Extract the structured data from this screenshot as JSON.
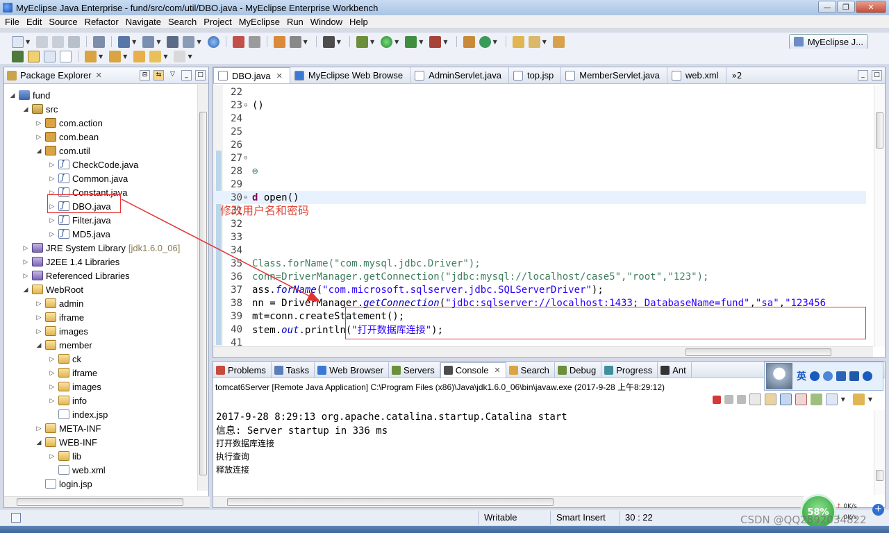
{
  "window": {
    "title": "MyEclipse Java Enterprise - fund/src/com/util/DBO.java - MyEclipse Enterprise Workbench"
  },
  "menu": [
    "File",
    "Edit",
    "Source",
    "Refactor",
    "Navigate",
    "Search",
    "Project",
    "MyEclipse",
    "Run",
    "Window",
    "Help"
  ],
  "perspective": {
    "label": "MyEclipse J..."
  },
  "package_explorer": {
    "title": "Package Explorer",
    "tree": [
      {
        "label": "fund",
        "icon": "project",
        "depth": 0,
        "twisty": "expanded"
      },
      {
        "label": "src",
        "icon": "srcfolder",
        "depth": 1,
        "twisty": "expanded"
      },
      {
        "label": "com.action",
        "icon": "package",
        "depth": 2,
        "twisty": "collapsed"
      },
      {
        "label": "com.bean",
        "icon": "package",
        "depth": 2,
        "twisty": "collapsed"
      },
      {
        "label": "com.util",
        "icon": "package",
        "depth": 2,
        "twisty": "expanded"
      },
      {
        "label": "CheckCode.java",
        "icon": "java",
        "depth": 3,
        "twisty": "collapsed"
      },
      {
        "label": "Common.java",
        "icon": "java",
        "depth": 3,
        "twisty": "collapsed"
      },
      {
        "label": "Constant.java",
        "icon": "java",
        "depth": 3,
        "twisty": "collapsed"
      },
      {
        "label": "DBO.java",
        "icon": "java",
        "depth": 3,
        "twisty": "collapsed",
        "selected": true
      },
      {
        "label": "Filter.java",
        "icon": "java",
        "depth": 3,
        "twisty": "collapsed"
      },
      {
        "label": "MD5.java",
        "icon": "java",
        "depth": 3,
        "twisty": "collapsed"
      },
      {
        "label": "JRE System Library",
        "icon": "lib",
        "depth": 1,
        "twisty": "collapsed",
        "decor": "[jdk1.6.0_06]"
      },
      {
        "label": "J2EE 1.4 Libraries",
        "icon": "lib",
        "depth": 1,
        "twisty": "collapsed"
      },
      {
        "label": "Referenced Libraries",
        "icon": "lib",
        "depth": 1,
        "twisty": "collapsed"
      },
      {
        "label": "WebRoot",
        "icon": "folder",
        "depth": 1,
        "twisty": "expanded"
      },
      {
        "label": "admin",
        "icon": "folder",
        "depth": 2,
        "twisty": "collapsed"
      },
      {
        "label": "iframe",
        "icon": "folder",
        "depth": 2,
        "twisty": "collapsed"
      },
      {
        "label": "images",
        "icon": "folder",
        "depth": 2,
        "twisty": "collapsed"
      },
      {
        "label": "member",
        "icon": "folder",
        "depth": 2,
        "twisty": "expanded"
      },
      {
        "label": "ck",
        "icon": "folder",
        "depth": 3,
        "twisty": "collapsed"
      },
      {
        "label": "iframe",
        "icon": "folder",
        "depth": 3,
        "twisty": "collapsed"
      },
      {
        "label": "images",
        "icon": "folder",
        "depth": 3,
        "twisty": "collapsed"
      },
      {
        "label": "info",
        "icon": "folder",
        "depth": 3,
        "twisty": "collapsed"
      },
      {
        "label": "index.jsp",
        "icon": "file",
        "depth": 3,
        "twisty": "none"
      },
      {
        "label": "META-INF",
        "icon": "folder",
        "depth": 2,
        "twisty": "collapsed"
      },
      {
        "label": "WEB-INF",
        "icon": "folder",
        "depth": 2,
        "twisty": "expanded"
      },
      {
        "label": "lib",
        "icon": "folder",
        "depth": 3,
        "twisty": "collapsed"
      },
      {
        "label": "web.xml",
        "icon": "file",
        "depth": 3,
        "twisty": "none"
      },
      {
        "label": "login.jsp",
        "icon": "file",
        "depth": 2,
        "twisty": "none"
      }
    ]
  },
  "editor": {
    "tabs": [
      {
        "label": "DBO.java",
        "icon_color": "#ffffff",
        "active": true
      },
      {
        "label": "MyEclipse Web Browse",
        "icon_color": "#3a7ad6"
      },
      {
        "label": "AdminServlet.java",
        "icon_color": "#ffffff"
      },
      {
        "label": "top.jsp",
        "icon_color": "#ffffff"
      },
      {
        "label": "MemberServlet.java",
        "icon_color": "#ffffff"
      },
      {
        "label": "web.xml",
        "icon_color": "#ffffff"
      }
    ],
    "overflow_label": "»2",
    "annotation": "修改用户名和密码",
    "lines": [
      {
        "n": "22",
        "fold": "",
        "segs": []
      },
      {
        "n": "23",
        "fold": "⊖",
        "segs": [
          {
            "t": "()",
            "c": ""
          }
        ]
      },
      {
        "n": "24",
        "fold": "",
        "segs": []
      },
      {
        "n": "25",
        "fold": "",
        "segs": []
      },
      {
        "n": "26",
        "fold": "",
        "segs": []
      },
      {
        "n": "27",
        "fold": "⊖",
        "segs": []
      },
      {
        "n": "28",
        "fold": "",
        "segs": [
          {
            "t": "⊜",
            "c": "comment"
          }
        ]
      },
      {
        "n": "29",
        "fold": "",
        "segs": []
      },
      {
        "n": "30",
        "fold": "⊖",
        "current": true,
        "segs": [
          {
            "t": "d",
            "c": "kw"
          },
          {
            "t": " open()",
            "c": ""
          }
        ]
      },
      {
        "n": "31",
        "fold": "",
        "segs": []
      },
      {
        "n": "32",
        "fold": "",
        "segs": []
      },
      {
        "n": "33",
        "fold": "",
        "segs": []
      },
      {
        "n": "34",
        "fold": "",
        "segs": []
      },
      {
        "n": "35",
        "fold": "",
        "segs": [
          {
            "t": "Class.forName(\"com.mysql.jdbc.Driver\");",
            "c": "comment"
          }
        ]
      },
      {
        "n": "36",
        "fold": "",
        "segs": [
          {
            "t": "conn=DriverManager.getConnection(\"jdbc:mysql://localhost/case5\",\"root\",\"123\");",
            "c": "comment"
          }
        ]
      },
      {
        "n": "37",
        "fold": "",
        "segs": [
          {
            "t": "ass.",
            "c": ""
          },
          {
            "t": "forName",
            "c": "stat"
          },
          {
            "t": "(",
            "c": ""
          },
          {
            "t": "\"com.microsoft.sqlserver.jdbc.SQLServerDriver\"",
            "c": "str"
          },
          {
            "t": ");",
            "c": ""
          }
        ]
      },
      {
        "n": "38",
        "fold": "",
        "segs": [
          {
            "t": "nn = DriverManager.",
            "c": ""
          },
          {
            "t": "getConnection",
            "c": "stat"
          },
          {
            "t": "(",
            "c": ""
          },
          {
            "t": "\"jdbc:sqlserver://localhost:1433; DatabaseName=fund\"",
            "c": "str"
          },
          {
            "t": ",",
            "c": ""
          },
          {
            "t": "\"sa\"",
            "c": "str"
          },
          {
            "t": ",",
            "c": ""
          },
          {
            "t": "\"123456",
            "c": "str"
          }
        ]
      },
      {
        "n": "39",
        "fold": "",
        "segs": [
          {
            "t": "mt=conn.createStatement();",
            "c": ""
          }
        ]
      },
      {
        "n": "40",
        "fold": "",
        "segs": [
          {
            "t": "stem.",
            "c": ""
          },
          {
            "t": "out",
            "c": "stat"
          },
          {
            "t": ".println(",
            "c": ""
          },
          {
            "t": "\"打开数据库连接\"",
            "c": "str"
          },
          {
            "t": ");",
            "c": ""
          }
        ]
      },
      {
        "n": "41",
        "fold": "",
        "segs": []
      }
    ]
  },
  "console": {
    "tabs": [
      {
        "label": "Problems",
        "icon_color": "#c94a3a"
      },
      {
        "label": "Tasks",
        "icon_color": "#5a7fb8"
      },
      {
        "label": "Web Browser",
        "icon_color": "#3a7ad6"
      },
      {
        "label": "Servers",
        "icon_color": "#6b8f3a"
      },
      {
        "label": "Console",
        "icon_color": "#4c4c4c",
        "active": true
      },
      {
        "label": "Search",
        "icon_color": "#d9a441"
      },
      {
        "label": "Debug",
        "icon_color": "#6b8f3a"
      },
      {
        "label": "Progress",
        "icon_color": "#3f8f9f"
      },
      {
        "label": "Ant",
        "icon_color": "#333333"
      }
    ],
    "description": "tomcat6Server [Remote Java Application] C:\\Program Files (x86)\\Java\\jdk1.6.0_06\\bin\\javaw.exe (2017-9-28 上午8:29:12)",
    "output": [
      {
        "text": "2017-9-28 8:29:13 org.apache.catalina.startup.Catalina start",
        "small": false
      },
      {
        "text": "信息: Server startup in 336 ms",
        "small": false
      },
      {
        "text": "打开数据库连接",
        "small": true
      },
      {
        "text": "执行查询",
        "small": true
      },
      {
        "text": "释放连接",
        "small": true
      }
    ]
  },
  "ime": {
    "label": "英"
  },
  "status": {
    "writable": "Writable",
    "insert_mode": "Smart Insert",
    "position": "30 : 22"
  },
  "net": {
    "percent": "58%",
    "up": "0K/s",
    "down": "0K/s"
  },
  "watermark": "CSDN @QQ2892034822",
  "colors": {
    "accent_red": "#e53333",
    "editor_bg": "#ffffff",
    "panel_border": "#99a8c2"
  }
}
